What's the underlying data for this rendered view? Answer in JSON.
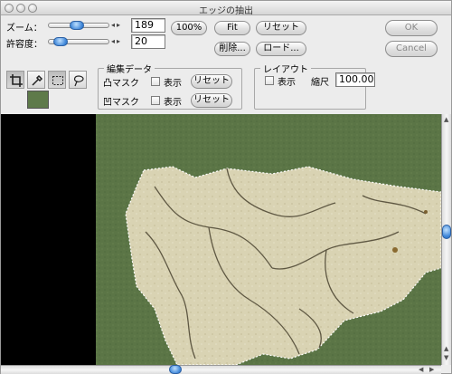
{
  "window": {
    "title": "エッジの抽出"
  },
  "zoom": {
    "label": "ズーム：",
    "value": "189"
  },
  "tolerance": {
    "label": "許容度：",
    "value": "20"
  },
  "buttons": {
    "zoom_100": "100%",
    "fit": "Fit",
    "reset": "リセット",
    "delete": "削除...",
    "load": "ロード...",
    "ok": "OK",
    "cancel": "Cancel"
  },
  "edit_data": {
    "title": "編集データ",
    "convex_mask": "凸マスク",
    "concave_mask": "凹マスク",
    "show_label": "表示",
    "reset_label": "リセット"
  },
  "layout": {
    "title": "レイアウト",
    "show_label": "表示",
    "scale_label": "縮尺",
    "scale_value": "100.00"
  },
  "tools": [
    "crop-icon",
    "eyedropper-icon",
    "marquee-icon",
    "lasso-icon"
  ],
  "colors": {
    "swatch": "#5e7a4a",
    "background_green": "#5b7546",
    "fragment": "#d9d3b3",
    "accent_blue": "#3e86d8"
  }
}
